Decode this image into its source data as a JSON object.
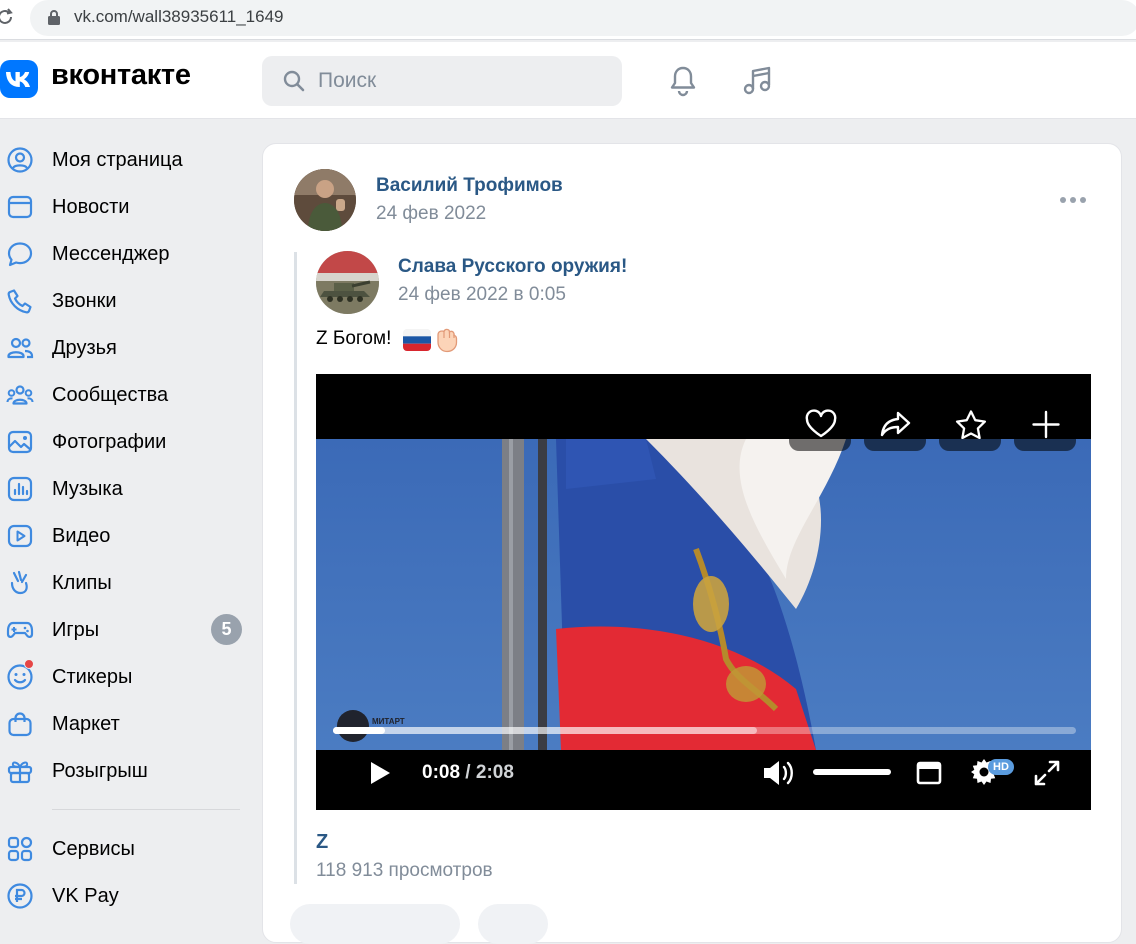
{
  "browser": {
    "url": "vk.com/wall38935611_1649"
  },
  "header": {
    "brand": "вконтакте",
    "search_placeholder": "Поиск"
  },
  "sidebar": {
    "items": [
      {
        "label": "Моя страница",
        "icon": "user-circle-icon"
      },
      {
        "label": "Новости",
        "icon": "news-icon"
      },
      {
        "label": "Мессенджер",
        "icon": "chat-icon"
      },
      {
        "label": "Звонки",
        "icon": "phone-icon"
      },
      {
        "label": "Друзья",
        "icon": "friends-icon"
      },
      {
        "label": "Сообщества",
        "icon": "communities-icon"
      },
      {
        "label": "Фотографии",
        "icon": "photos-icon"
      },
      {
        "label": "Музыка",
        "icon": "music-icon"
      },
      {
        "label": "Видео",
        "icon": "video-icon"
      },
      {
        "label": "Клипы",
        "icon": "clips-icon"
      },
      {
        "label": "Игры",
        "icon": "gamepad-icon",
        "count": "5"
      },
      {
        "label": "Стикеры",
        "icon": "smile-icon"
      },
      {
        "label": "Маркет",
        "icon": "bag-icon"
      },
      {
        "label": "Розыгрыш",
        "icon": "gift-icon"
      }
    ],
    "extra": [
      {
        "label": "Сервисы",
        "icon": "services-icon"
      },
      {
        "label": "VK Pay",
        "icon": "vkpay-icon"
      }
    ]
  },
  "post": {
    "author": "Василий Трофимов",
    "date": "24 фев 2022",
    "repost": {
      "author": "Слава Русского оружия!",
      "date": "24 фев 2022 в 0:05",
      "text": "Z Богом!"
    },
    "video": {
      "current_time": "0:08",
      "separator": " / ",
      "duration": "2:08",
      "progress_played": 0.07,
      "progress_buffered": 0.57,
      "quality_badge": "HD",
      "watermark": "МИТАРТ"
    },
    "video_title": "Z",
    "views": "118 913 просмотров"
  },
  "colors": {
    "accent": "#0077ff",
    "link": "#2a5885",
    "muted": "#818c99",
    "background": "#edeef0"
  }
}
